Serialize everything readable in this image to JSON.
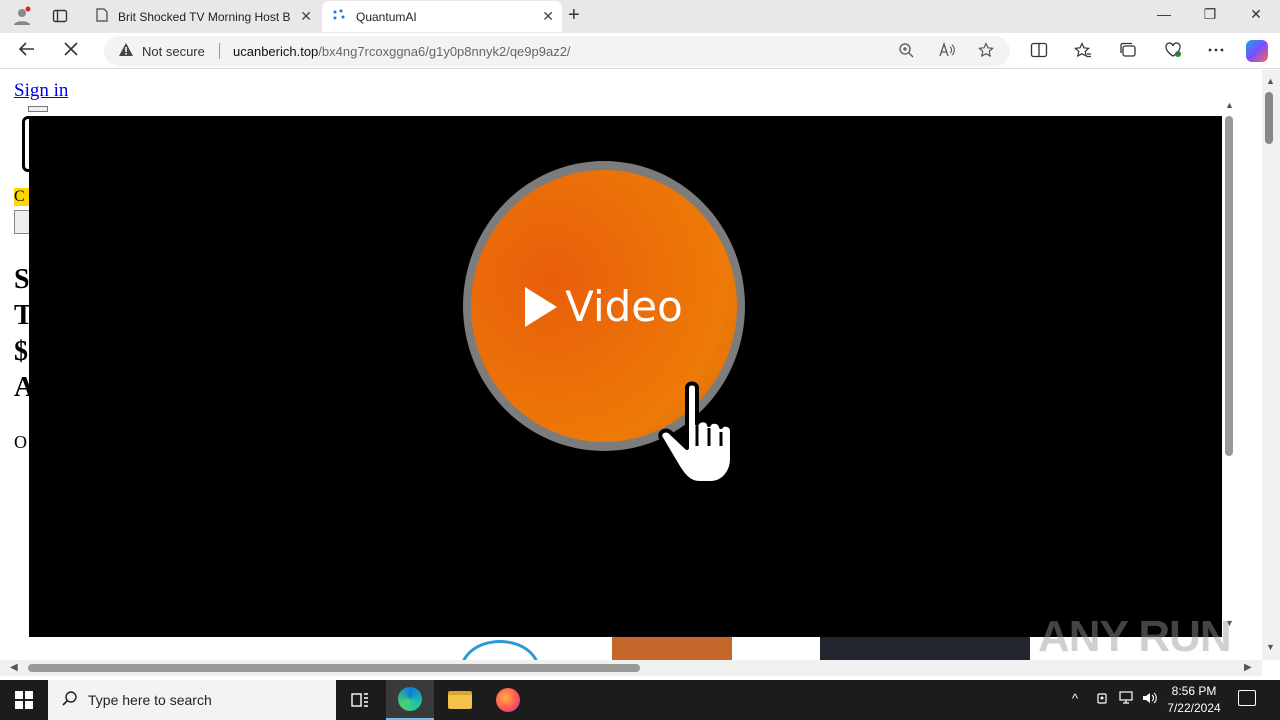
{
  "browser": {
    "tabs": [
      {
        "title": "Brit Shocked TV Morning Host By",
        "active": false
      },
      {
        "title": "QuantumAI",
        "active": true
      }
    ],
    "address": {
      "security_label": "Not secure",
      "url_host": "ucanberich.top",
      "url_path": "/bx4ng7rcoxggna6/g1y0p8nnyk2/qe9p9az2/"
    }
  },
  "page": {
    "signin_label": "Sign in",
    "bg_lines": [
      "S",
      "T",
      "$",
      "A"
    ],
    "bg_small": "O",
    "yellow_tag": "C",
    "video_button_label": "Video"
  },
  "watermark": "ANY RUN",
  "taskbar": {
    "search_placeholder": "Type here to search",
    "time": "8:56 PM",
    "date": "7/22/2024"
  },
  "colors": {
    "overlay": "#000000",
    "video_button": "#ed6d0a",
    "link": "#0000ee"
  }
}
